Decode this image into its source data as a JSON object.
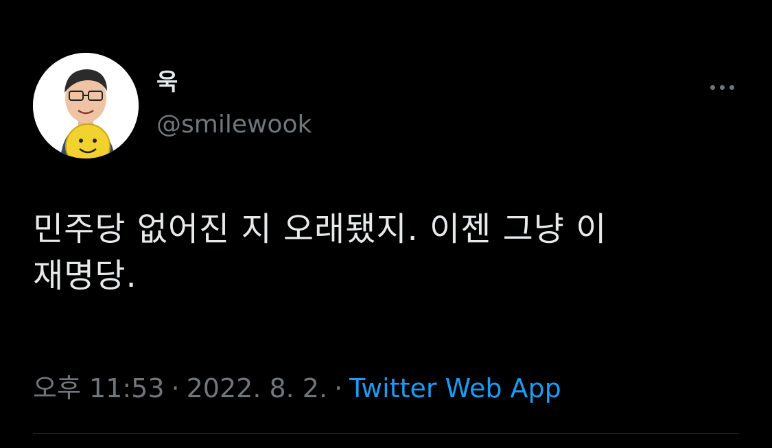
{
  "user": {
    "display_name": "욱",
    "handle": "@smilewook"
  },
  "tweet": {
    "text": "민주당 없어진 지 오래됐지. 이젠 그냥 이\n재명당."
  },
  "meta": {
    "time": "오후 11:53",
    "separator": "·",
    "date": "2022. 8. 2.",
    "source": "Twitter Web App"
  },
  "colors": {
    "background": "#000000",
    "text": "#e7e9ea",
    "secondary": "#71767b",
    "link": "#1d9bf0",
    "divider": "#2f3336"
  },
  "icons": {
    "more": "more-horizontal-icon"
  }
}
